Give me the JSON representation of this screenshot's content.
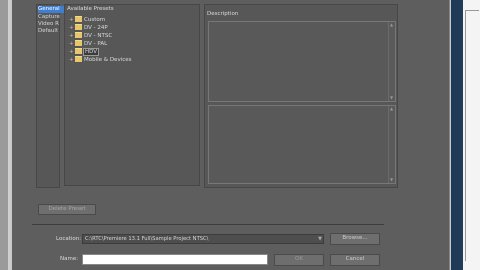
{
  "sidebar": {
    "tabs": [
      {
        "label": "General"
      },
      {
        "label": "Capture"
      },
      {
        "label": "Video R"
      },
      {
        "label": "Default"
      }
    ]
  },
  "presets": {
    "title": "Available Presets",
    "items": [
      {
        "label": "Custom",
        "expander": "+"
      },
      {
        "label": "DV - 24P",
        "expander": "+"
      },
      {
        "label": "DV - NTSC",
        "expander": "+"
      },
      {
        "label": "DV - PAL",
        "expander": "+"
      },
      {
        "label": "HDV",
        "expander": "+"
      },
      {
        "label": "Mobile & Devices",
        "expander": "+"
      }
    ]
  },
  "description": {
    "title": "Description"
  },
  "buttons": {
    "delete": "Delete Preset",
    "browse": "Browse...",
    "ok": "OK",
    "cancel": "Cancel"
  },
  "location": {
    "label": "Location:",
    "value": "C:\\RTC\\Premiere 13.1 Full\\Sample Project NTSC\\"
  },
  "name": {
    "label": "Name:",
    "value": ""
  }
}
